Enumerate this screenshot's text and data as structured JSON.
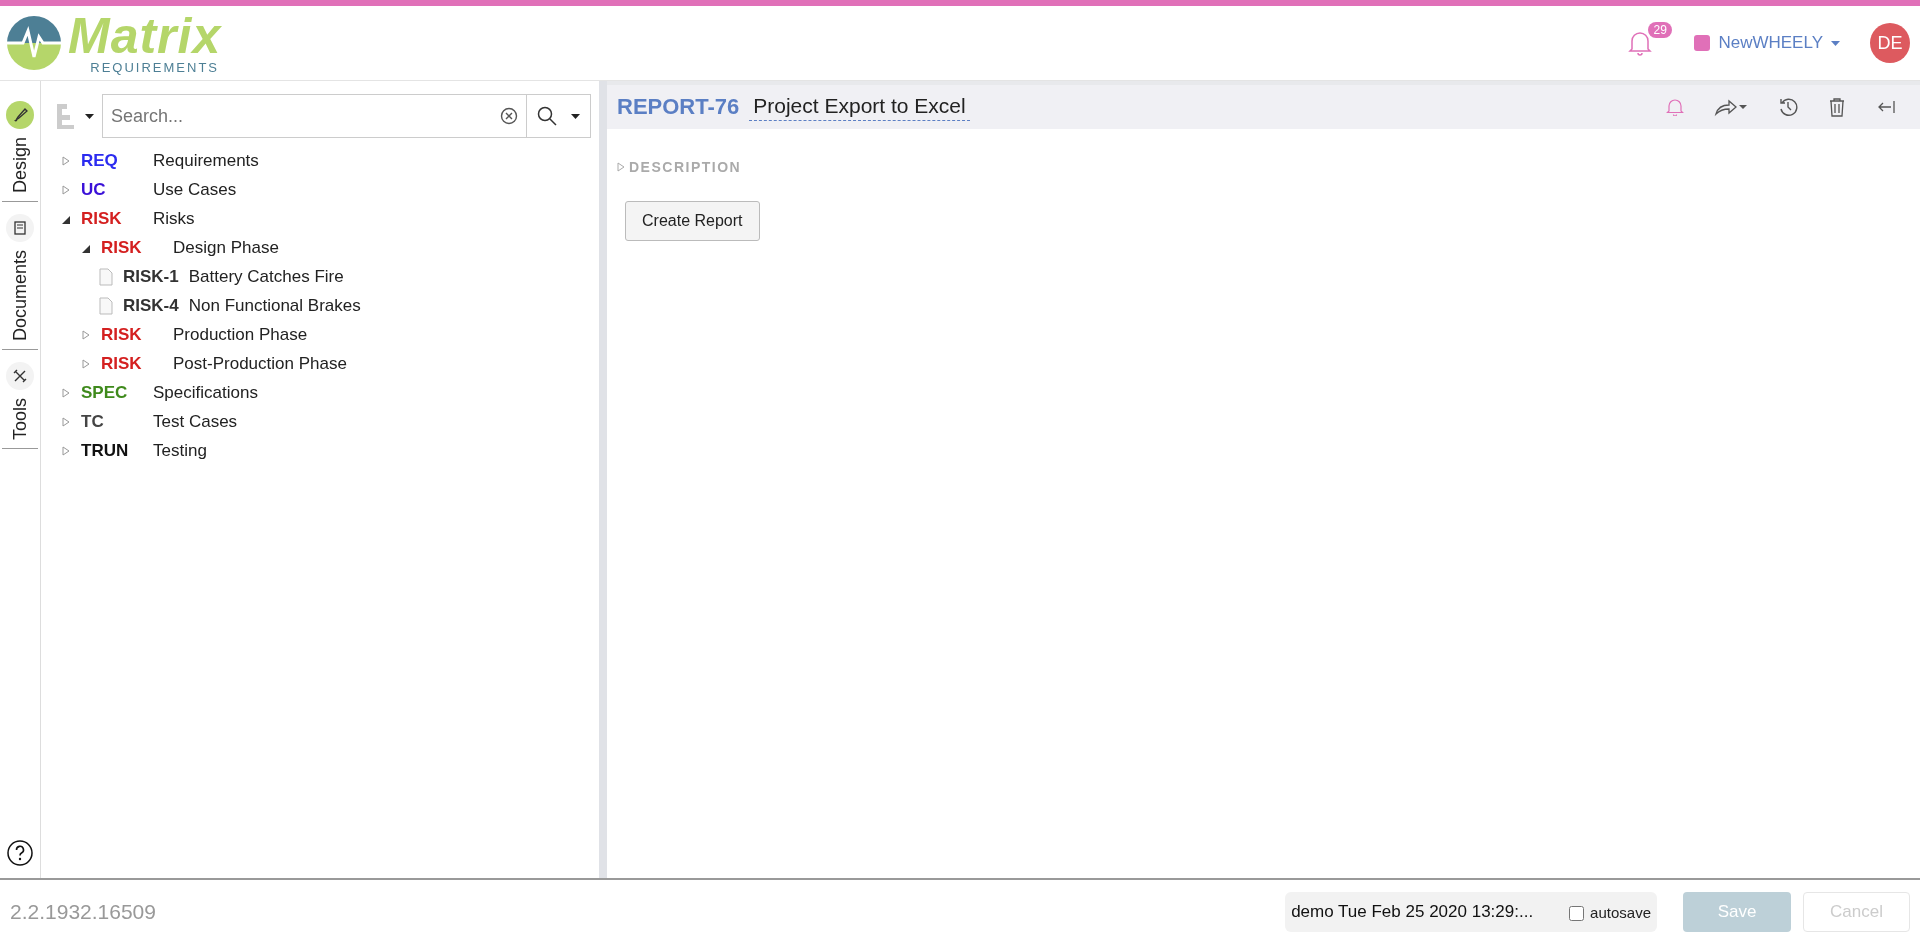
{
  "header": {
    "logo": {
      "name": "Matrix",
      "tagline": "REQUIREMENTS"
    },
    "notifications": {
      "count": "29"
    },
    "project": {
      "name": "NewWHEELY",
      "color": "#e070b8"
    },
    "user": {
      "initials": "DE"
    }
  },
  "side_tabs": [
    {
      "label": "Design",
      "selected": true
    },
    {
      "label": "Documents",
      "selected": false
    },
    {
      "label": "Tools",
      "selected": false
    }
  ],
  "tree_panel": {
    "search": {
      "placeholder": "Search..."
    },
    "tree": [
      {
        "kind": "folder",
        "category": "REQ",
        "label": "Requirements",
        "color": "#2b2bf0",
        "expanded": false
      },
      {
        "kind": "folder",
        "category": "UC",
        "label": "Use Cases",
        "color": "#3a10d8",
        "expanded": false
      },
      {
        "kind": "folder",
        "category": "RISK",
        "label": "Risks",
        "color": "#d42020",
        "expanded": true,
        "children": [
          {
            "kind": "folder",
            "category": "RISK",
            "label": "Design Phase",
            "color": "#d42020",
            "expanded": true,
            "children": [
              {
                "kind": "item",
                "category": "RISK-1",
                "label": "Battery Catches Fire",
                "color": "#333333"
              },
              {
                "kind": "item",
                "category": "RISK-4",
                "label": "Non Functional Brakes",
                "color": "#333333"
              }
            ]
          },
          {
            "kind": "folder",
            "category": "RISK",
            "label": "Production Phase",
            "color": "#d42020",
            "expanded": false
          },
          {
            "kind": "folder",
            "category": "RISK",
            "label": "Post-Production Phase",
            "color": "#d42020",
            "expanded": false
          }
        ]
      },
      {
        "kind": "folder",
        "category": "SPEC",
        "label": "Specifications",
        "color": "#3f8a1c",
        "expanded": false
      },
      {
        "kind": "folder",
        "category": "TC",
        "label": "Test Cases",
        "color": "#444444",
        "expanded": false
      },
      {
        "kind": "folder",
        "category": "TRUN",
        "label": "Testing",
        "color": "#111111",
        "expanded": false
      }
    ]
  },
  "item_panel": {
    "id": "REPORT-76",
    "title": "Project Export to Excel",
    "section": {
      "label": "DESCRIPTION",
      "expanded": false
    },
    "action": "Create Report"
  },
  "footer": {
    "version": "2.2.1932.16509",
    "status": "demo Tue Feb 25 2020 13:29:...",
    "autosave": {
      "label": "autosave",
      "checked": false
    },
    "buttons": [
      {
        "label": "Save",
        "kind": "primary",
        "disabled": true
      },
      {
        "label": "Cancel",
        "kind": "default",
        "disabled": true
      }
    ]
  }
}
